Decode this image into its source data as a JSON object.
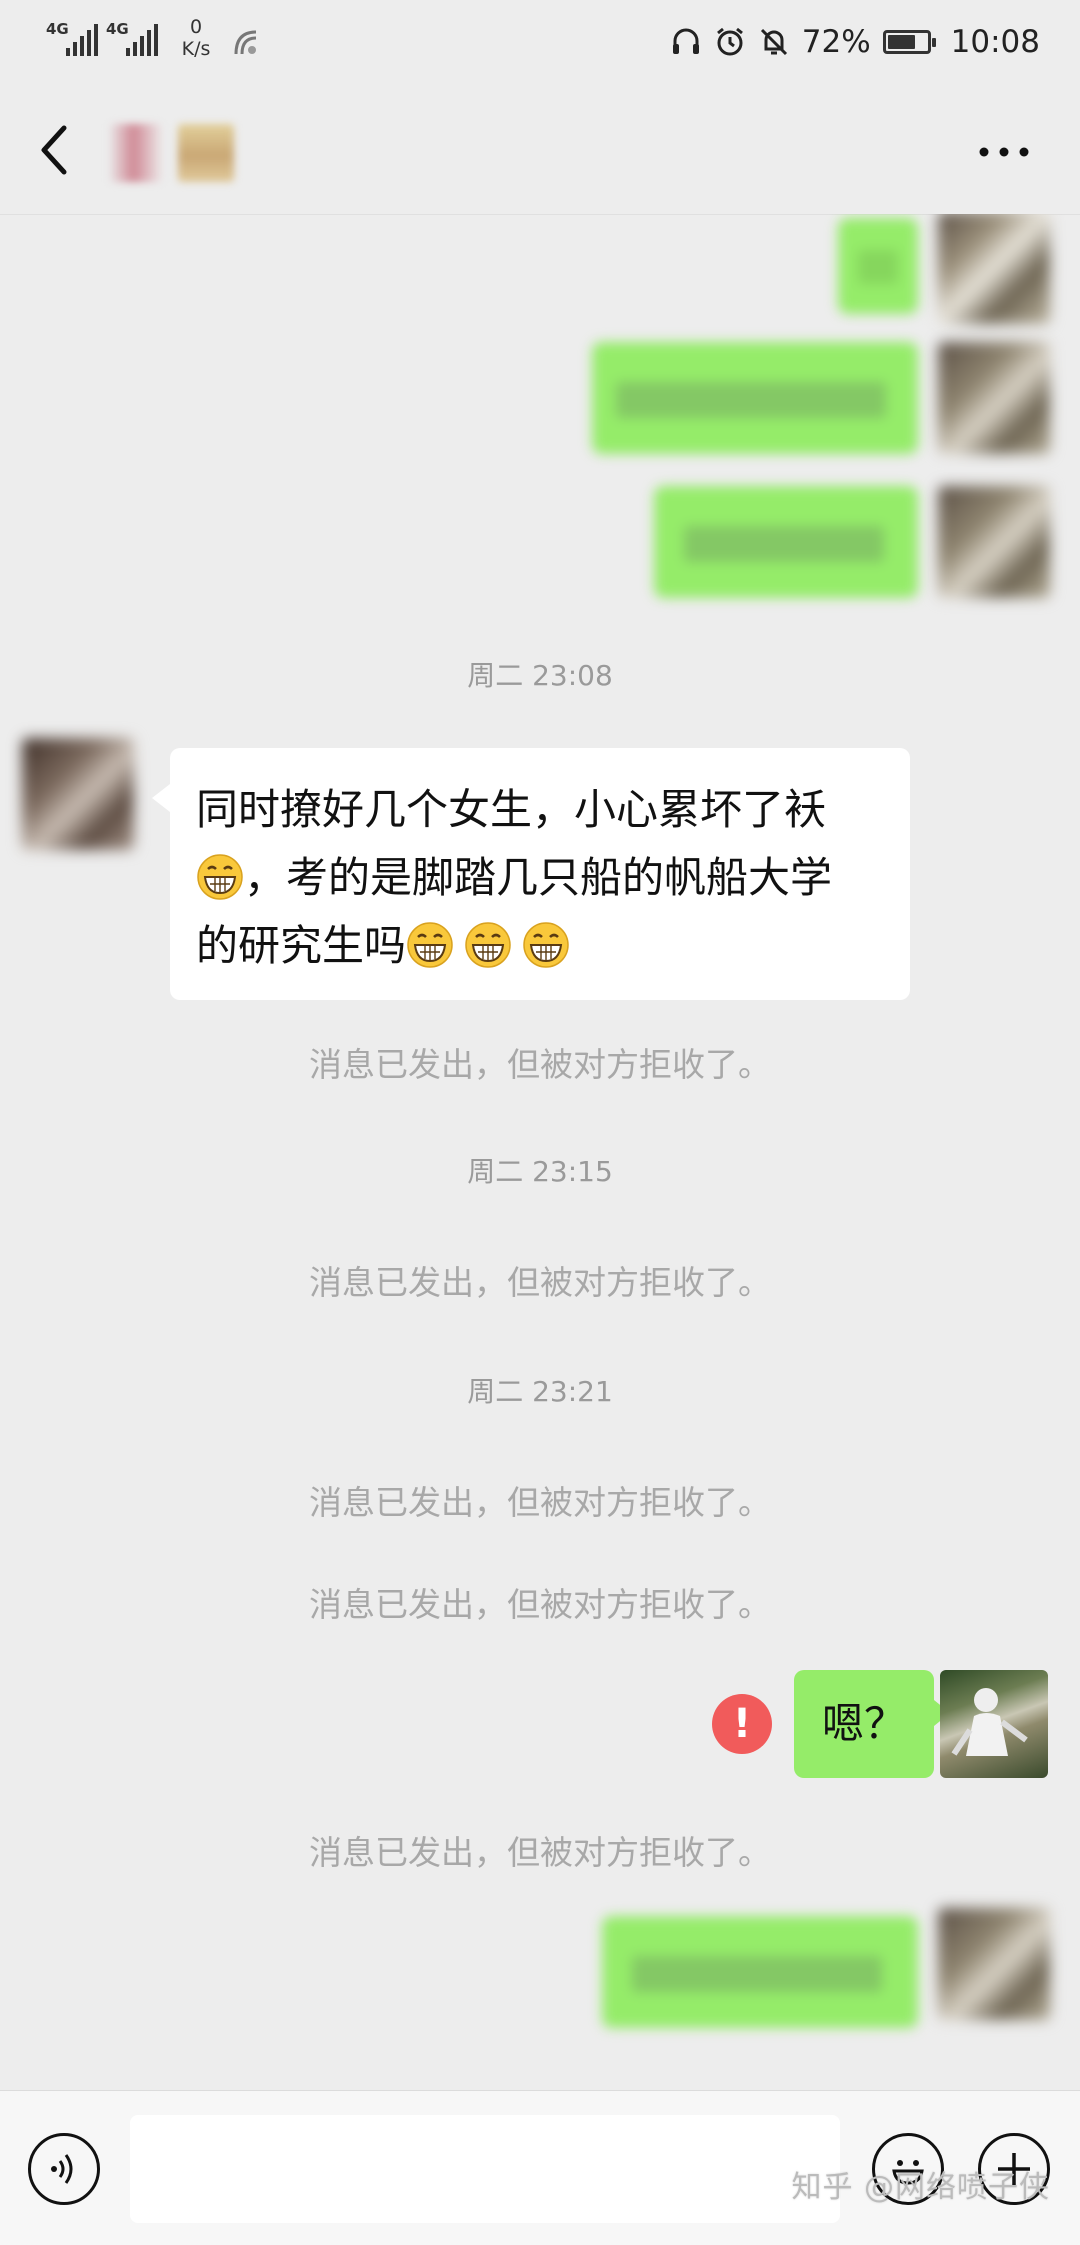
{
  "status_bar": {
    "signal_1": "4G",
    "signal_2": "4G",
    "speed_value": "0",
    "speed_unit": "K/s",
    "battery": "72%",
    "battery_level": 0.72,
    "time": "10:08"
  },
  "header": {
    "back_icon": "chevron-left-icon",
    "more_icon": "more-dots-icon"
  },
  "messages": {
    "ts_1": "周二 23:08",
    "received_line_1": "同时撩好几个女生，小心累坏了袄",
    "received_line_2": "，考的是脚踏几只船的帆船大学",
    "received_line_3": "的研究生吗",
    "rejected_1": "消息已发出，但被对方拒收了。",
    "ts_2": "周二 23:15",
    "rejected_2": "消息已发出，但被对方拒收了。",
    "ts_3": "周二 23:21",
    "rejected_3": "消息已发出，但被对方拒收了。",
    "rejected_4": "消息已发出，但被对方拒收了。",
    "sent_reply": "嗯？",
    "error_mark": "!",
    "rejected_5": "消息已发出，但被对方拒收了。"
  },
  "input_bar": {
    "voice_icon": "voice-icon",
    "emoji_icon": "emoji-icon",
    "plus_icon": "plus-icon"
  },
  "watermark": "知乎 @网络喷子侠",
  "colors": {
    "chat_bg": "#ededed",
    "sent_bubble": "#95ec69",
    "received_bubble": "#ffffff",
    "system_text": "#a8a8a8",
    "error_badge": "#f15b5b"
  }
}
